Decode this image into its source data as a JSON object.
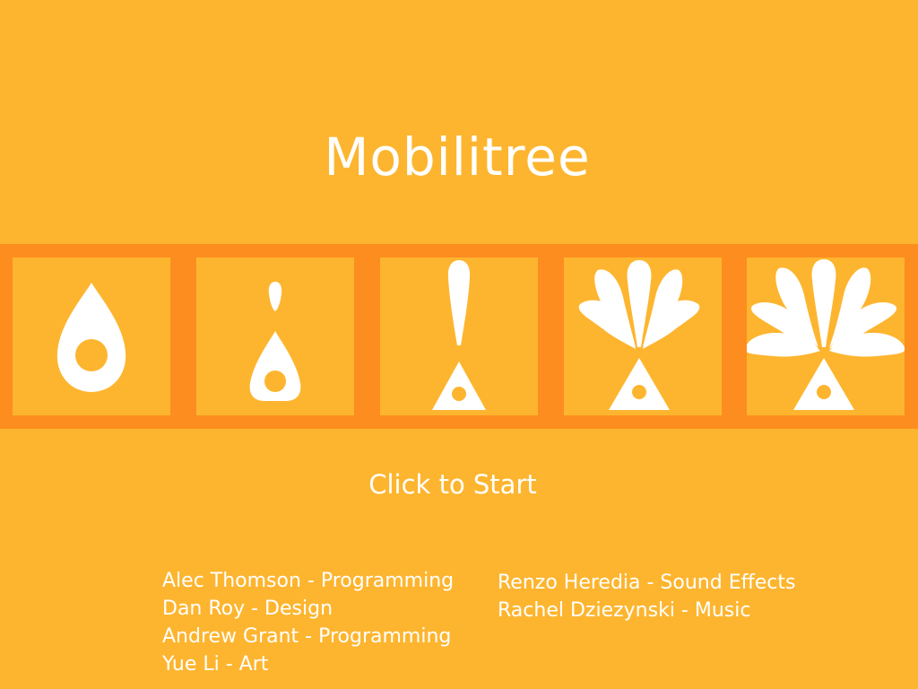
{
  "app": {
    "title": "Mobilitree",
    "start_label": "Click to Start"
  },
  "stages": [
    {
      "icon": "seed-icon"
    },
    {
      "icon": "sprout-icon"
    },
    {
      "icon": "stem-icon"
    },
    {
      "icon": "small-tree-icon"
    },
    {
      "icon": "full-tree-icon"
    }
  ],
  "credits": {
    "left": [
      "Alec Thomson - Programming",
      "Dan Roy - Design",
      "Andrew Grant - Programming",
      "Yue Li - Art"
    ],
    "right": [
      "Renzo Heredia - Sound Effects",
      "Rachel Dziezynski - Music"
    ]
  },
  "colors": {
    "background": "#FDB52F",
    "strip": "#FD8D1F",
    "foreground": "#FFFFFF"
  }
}
